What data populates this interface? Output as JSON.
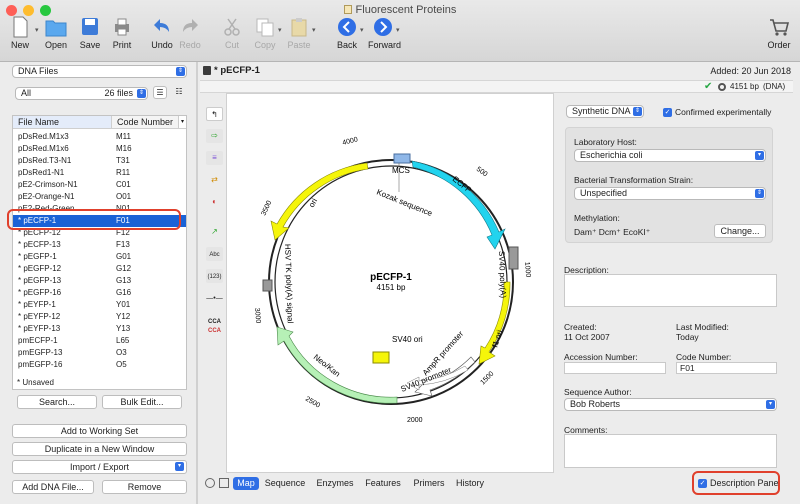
{
  "window": {
    "title": "Fluorescent Proteins"
  },
  "toolbar": {
    "new": "New",
    "open": "Open",
    "save": "Save",
    "print": "Print",
    "undo": "Undo",
    "redo": "Redo",
    "cut": "Cut",
    "copy": "Copy",
    "paste": "Paste",
    "back": "Back",
    "forward": "Forward",
    "order": "Order"
  },
  "left": {
    "files_select": "DNA Files",
    "filter_select": "All",
    "files_count": "26 files",
    "columns": {
      "name": "File Name",
      "code": "Code Number"
    },
    "rows": [
      {
        "name": "pDsRed.M1x3",
        "code": "M11"
      },
      {
        "name": "pDsRed.M1x6",
        "code": "M16"
      },
      {
        "name": "pDsRed.T3-N1",
        "code": "T31"
      },
      {
        "name": "pDsRed1-N1",
        "code": "R11"
      },
      {
        "name": "pE2-Crimson-N1",
        "code": "C01"
      },
      {
        "name": "pE2-Orange-N1",
        "code": "O01"
      },
      {
        "name": "pE2-Red-Green",
        "code": "N01"
      },
      {
        "name": "* pECFP-1",
        "code": "F01"
      },
      {
        "name": "* pECFP-12",
        "code": "F12"
      },
      {
        "name": "* pECFP-13",
        "code": "F13"
      },
      {
        "name": "* pEGFP-1",
        "code": "G01"
      },
      {
        "name": "* pEGFP-12",
        "code": "G12"
      },
      {
        "name": "* pEGFP-13",
        "code": "G13"
      },
      {
        "name": "* pEGFP-16",
        "code": "G16"
      },
      {
        "name": "* pEYFP-1",
        "code": "Y01"
      },
      {
        "name": "* pEYFP-12",
        "code": "Y12"
      },
      {
        "name": "* pEYFP-13",
        "code": "Y13"
      },
      {
        "name": "pmECFP-1",
        "code": "L65"
      },
      {
        "name": "pmEGFP-13",
        "code": "O3"
      },
      {
        "name": "pmEGFP-16",
        "code": "O5"
      }
    ],
    "unsaved_note": "* Unsaved",
    "search_btn": "Search...",
    "bulk_edit_btn": "Bulk Edit...",
    "add_working_set": "Add to Working Set",
    "duplicate_window": "Duplicate in a New Window",
    "import_export": "Import / Export",
    "add_dna": "Add DNA File...",
    "remove": "Remove"
  },
  "doc": {
    "name": "* pECFP-1",
    "added": "Added:  20 Jun 2018",
    "size": "4151 bp",
    "topology": "(DNA)"
  },
  "map": {
    "name": "pECFP-1",
    "size": "4151 bp",
    "ticks": [
      "4000",
      "500",
      "1000",
      "1500",
      "2000",
      "2500",
      "3000",
      "3500"
    ],
    "features": [
      "MCS",
      "ECFP",
      "Kozak sequence",
      "SV40 poly(A)",
      "f1 ori",
      "AmpR promoter",
      "SV40 ori",
      "SV40 promoter",
      "Neo/Kan",
      "HSV TK poly(A) signal",
      "ori"
    ]
  },
  "details": {
    "seq_type": "Synthetic DNA",
    "confirmed": "Confirmed experimentally",
    "lab_host_label": "Laboratory Host:",
    "lab_host": "Escherichia coli",
    "strain_label": "Bacterial Transformation Strain:",
    "strain": "Unspecified",
    "methylation_label": "Methylation:",
    "methylation": "Dam⁺  Dcm⁺  EcoKI⁺",
    "change_btn": "Change...",
    "description_label": "Description:",
    "created_label": "Created:",
    "created": "11 Oct 2007",
    "modified_label": "Last Modified:",
    "modified": "Today",
    "accession_label": "Accession Number:",
    "code_label": "Code Number:",
    "code": "F01",
    "author_label": "Sequence Author:",
    "author": "Bob Roberts",
    "comments_label": "Comments:",
    "desc_panel": "Description Panel"
  },
  "tabs": [
    "Map",
    "Sequence",
    "Enzymes",
    "Features",
    "Primers",
    "History"
  ],
  "colors": {
    "accent": "#2f6ee5",
    "highlight": "#e0402c",
    "ecfp": "#22d3ee",
    "yellow": "#f5f50a",
    "green": "#b6f0b6"
  }
}
